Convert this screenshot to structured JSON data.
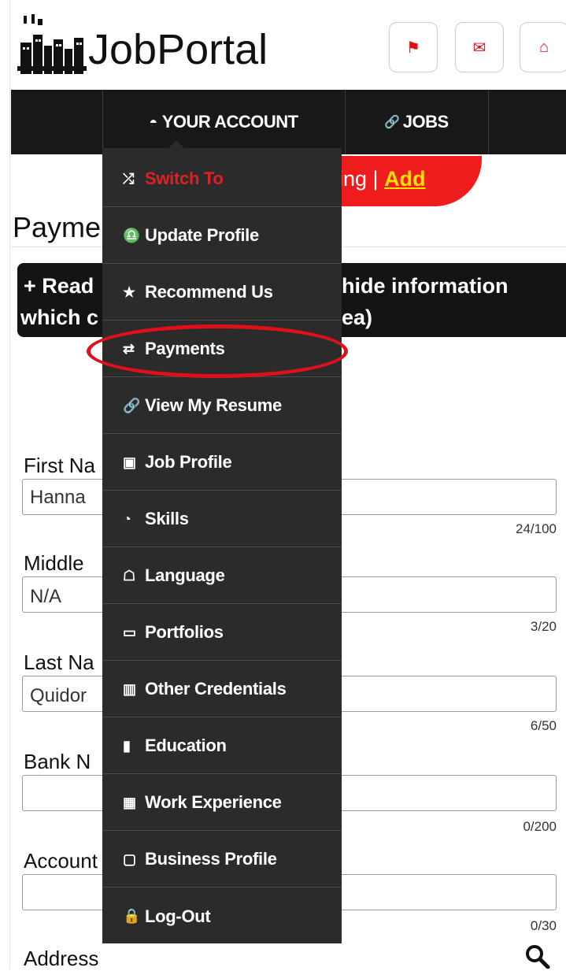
{
  "header": {
    "logo_text": "JobPortal",
    "buttons": [
      {
        "name": "flag-icon",
        "glyph": "⚑"
      },
      {
        "name": "mail-icon",
        "glyph": "✉"
      },
      {
        "name": "home-icon",
        "glyph": "⌂"
      }
    ]
  },
  "nav": {
    "your_account": "YOUR ACCOUNT",
    "jobs": "JOBS",
    "your_account_icon": "◓",
    "jobs_icon": "🔗"
  },
  "banner": {
    "text": "ing | ",
    "add": "Add"
  },
  "page": {
    "title": "Payme"
  },
  "info_box": {
    "line1_left": "+ Read",
    "line1_right": "hide information",
    "line2_left": "which c",
    "line2_right": "ea)"
  },
  "form": {
    "first_name_label": "First Na",
    "first_name_value": "Hanna",
    "first_name_count": "24/100",
    "middle_label": "Middle",
    "middle_value": "N/A",
    "middle_count": "3/20",
    "last_name_label": "Last Na",
    "last_name_value": "Quidor",
    "last_name_count": "6/50",
    "bank_label": "Bank N",
    "bank_count": "0/200",
    "account_label": "Account",
    "account_count": "0/30",
    "address_label": "Address"
  },
  "dropdown": {
    "items": [
      {
        "label": "Switch To",
        "icon": "⤮"
      },
      {
        "label": "Update Profile",
        "icon": "♎"
      },
      {
        "label": "Recommend Us",
        "icon": "★"
      },
      {
        "label": "Payments",
        "icon": "⇄"
      },
      {
        "label": "View My Resume",
        "icon": "🔗"
      },
      {
        "label": "Job Profile",
        "icon": "▣"
      },
      {
        "label": "Skills",
        "icon": "◔"
      },
      {
        "label": "Language",
        "icon": "☖"
      },
      {
        "label": "Portfolios",
        "icon": "▭"
      },
      {
        "label": "Other Credentials",
        "icon": "▥"
      },
      {
        "label": "Education",
        "icon": "▮"
      },
      {
        "label": "Work Experience",
        "icon": "▦"
      },
      {
        "label": "Business Profile",
        "icon": "▢"
      },
      {
        "label": "Log-Out",
        "icon": "🔒"
      }
    ]
  },
  "colors": {
    "nav_bg": "#181818",
    "dropdown_bg": "#2b2b2b",
    "accent_red": "#ee1c1c",
    "add_yellow": "#ffe000"
  }
}
